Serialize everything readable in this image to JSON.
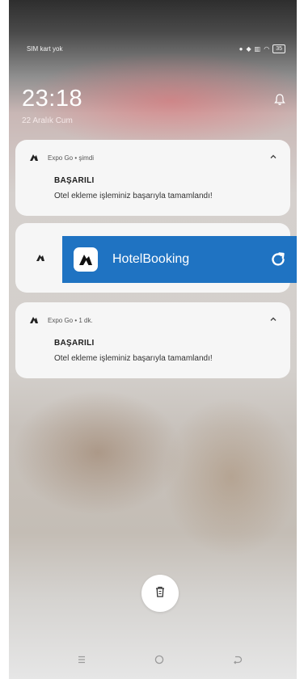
{
  "status_bar": {
    "carrier": "SIM kart yok",
    "battery": "35"
  },
  "lockscreen": {
    "time": "23:18",
    "date": "22 Aralık Cum"
  },
  "notifications": [
    {
      "source": "Expo Go • şimdi",
      "title": "BAŞARILI",
      "body": "Otel ekleme işleminiz başarıyla tamamlandı!"
    },
    {
      "source": "Expo Go • 1 dk.",
      "title": "BAŞARILI",
      "body": "Otel ekleme işleminiz başarıyla tamamlandı!"
    }
  ],
  "banner": {
    "title": "HotelBooking",
    "color": "#1f73c2"
  },
  "icons": {
    "app": "expo-logo-icon",
    "expand": "chevron-up-icon",
    "refresh": "refresh-icon",
    "bell": "notification-bell-icon",
    "clear": "trash-icon",
    "nav": [
      "menu-icon",
      "home-icon",
      "back-icon"
    ]
  }
}
